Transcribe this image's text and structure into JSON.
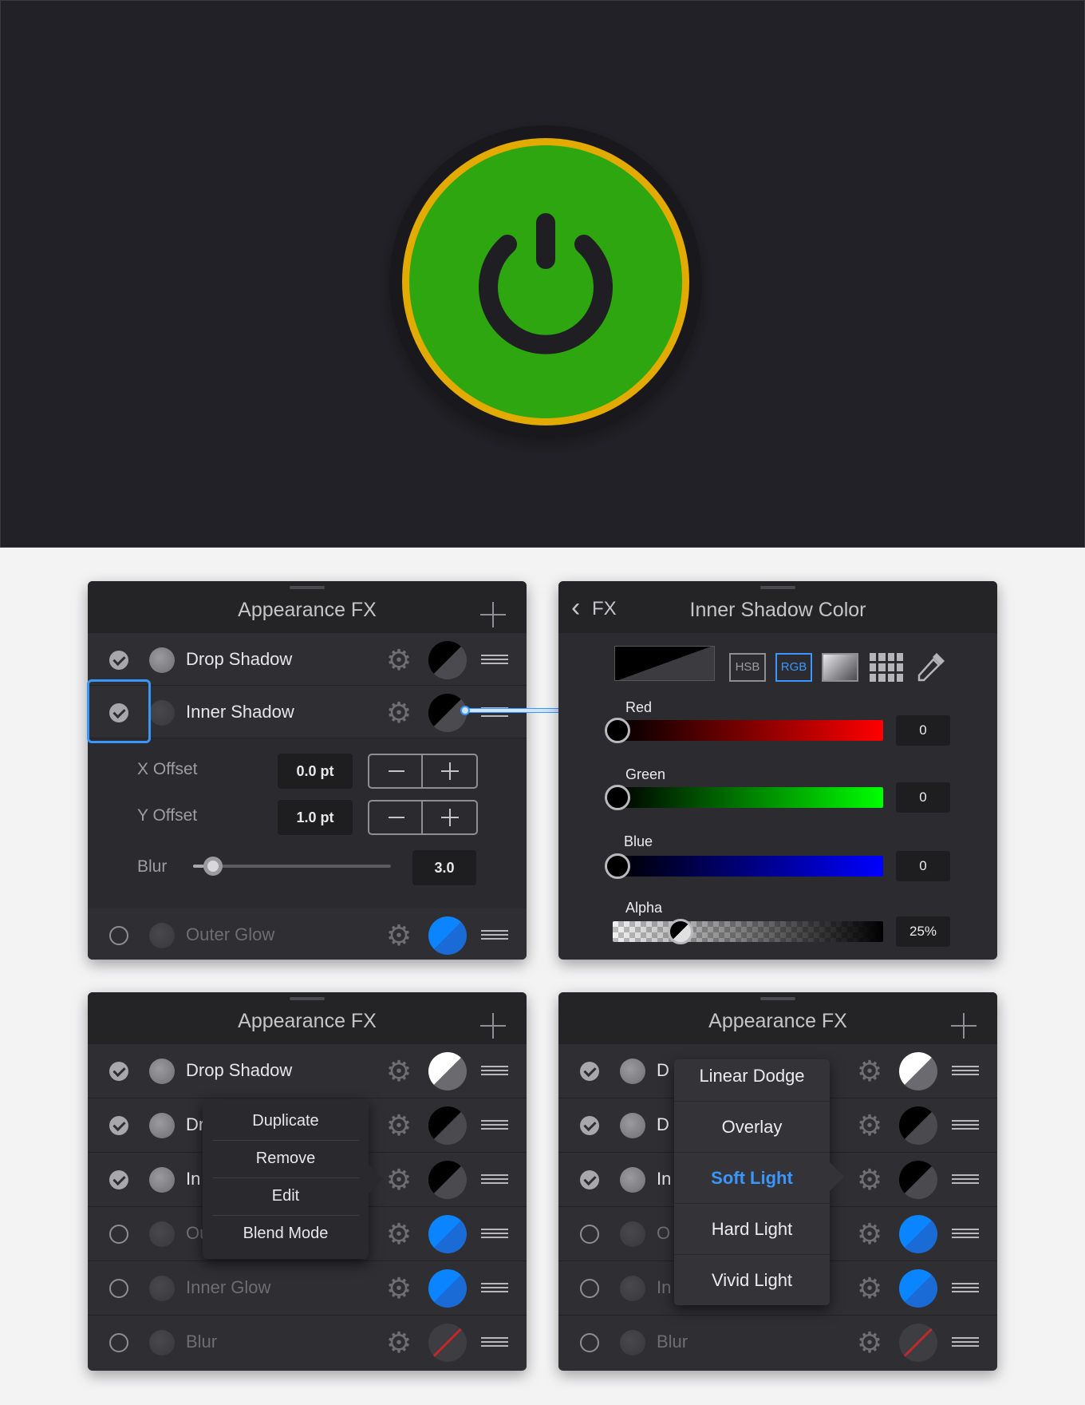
{
  "colors": {
    "power_green": "#2da610",
    "power_ring": "#e3aa00",
    "accent_blue": "#0a84ff",
    "selection_blue": "#3a96ff"
  },
  "hero": {
    "icon": "power-icon"
  },
  "panel_fx_detail": {
    "title": "Appearance FX",
    "rows": [
      {
        "label": "Drop Shadow",
        "enabled": true,
        "swatch": "black"
      },
      {
        "label": "Inner Shadow",
        "enabled": true,
        "swatch": "black"
      },
      {
        "label": "Outer Glow",
        "enabled": false,
        "swatch": "blue"
      }
    ],
    "x_offset": {
      "label": "X Offset",
      "value": "0.0 pt"
    },
    "y_offset": {
      "label": "Y Offset",
      "value": "1.0 pt"
    },
    "blur": {
      "label": "Blur",
      "value": "3.0",
      "level": 0.1
    }
  },
  "panel_color": {
    "back_label": "FX",
    "title": "Inner Shadow Color",
    "modes": [
      "HSB",
      "RGB"
    ],
    "active_mode": "RGB",
    "channels": [
      {
        "label": "Red",
        "value": "0"
      },
      {
        "label": "Green",
        "value": "0"
      },
      {
        "label": "Blue",
        "value": "0"
      },
      {
        "label": "Alpha",
        "value": "25%",
        "level": 0.25
      }
    ]
  },
  "panel_context": {
    "title": "Appearance FX",
    "rows": [
      {
        "label": "Drop Shadow",
        "enabled": true,
        "swatch": "white"
      },
      {
        "label": "Dr",
        "enabled": true,
        "swatch": "black"
      },
      {
        "label": "In",
        "enabled": true,
        "swatch": "black"
      },
      {
        "label": "Ou",
        "enabled": false,
        "swatch": "blue"
      },
      {
        "label": "Inner Glow",
        "enabled": false,
        "swatch": "blue"
      },
      {
        "label": "Blur",
        "enabled": false,
        "swatch": "none"
      }
    ],
    "menu": [
      "Duplicate",
      "Remove",
      "Edit",
      "Blend Mode"
    ]
  },
  "panel_blend": {
    "title": "Appearance FX",
    "rows": [
      {
        "label": "D",
        "enabled": true,
        "swatch": "white"
      },
      {
        "label": "D",
        "enabled": true,
        "swatch": "black"
      },
      {
        "label": "In",
        "enabled": true,
        "swatch": "black"
      },
      {
        "label": "O",
        "enabled": false,
        "swatch": "blue"
      },
      {
        "label": "In",
        "enabled": false,
        "swatch": "blue"
      },
      {
        "label": "Blur",
        "enabled": false,
        "swatch": "none"
      }
    ],
    "blend_modes": [
      "Linear Dodge",
      "Overlay",
      "Soft Light",
      "Hard Light",
      "Vivid Light"
    ],
    "selected_mode": "Soft Light"
  }
}
